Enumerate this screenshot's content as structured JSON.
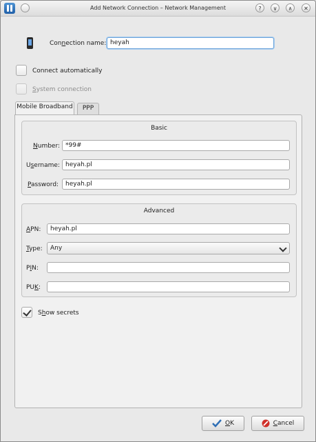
{
  "window": {
    "title": "Add Network Connection – Network Management",
    "buttons": [
      "?",
      "∨",
      "∧",
      "✕"
    ]
  },
  "connection": {
    "name_label_pre": "Con",
    "name_label_u": "n",
    "name_label_post": "ection name:",
    "name_value": "heyah"
  },
  "options": {
    "auto_label": "Connect automatically",
    "auto_checked": false,
    "system_label_u": "S",
    "system_label_post": "ystem connection",
    "system_checked": false
  },
  "tabs": [
    {
      "label": "Mobile Broadband",
      "active": true
    },
    {
      "label": "PPP",
      "active": false
    }
  ],
  "basic": {
    "title": "Basic",
    "number_label_u": "N",
    "number_label_post": "umber:",
    "number_value": "*99#",
    "username_label_pre": "U",
    "username_label_u": "s",
    "username_label_post": "ername:",
    "username_value": "heyah.pl",
    "password_label_u": "P",
    "password_label_post": "assword:",
    "password_value": "heyah.pl"
  },
  "advanced": {
    "title": "Advanced",
    "apn_label_u": "A",
    "apn_label_post": "PN:",
    "apn_value": "heyah.pl",
    "type_label_u": "T",
    "type_label_post": "ype:",
    "type_value": "Any",
    "pin_label_pre": "P",
    "pin_label_u": "I",
    "pin_label_post": "N:",
    "pin_value": "",
    "puk_label_pre": "PU",
    "puk_label_u": "K",
    "puk_label_post": ":",
    "puk_value": ""
  },
  "show_secrets": {
    "label_pre": "S",
    "label_u": "h",
    "label_post": "ow secrets",
    "checked": true
  },
  "footer": {
    "ok_u": "O",
    "ok_post": "K",
    "cancel_u": "C",
    "cancel_post": "ancel"
  }
}
